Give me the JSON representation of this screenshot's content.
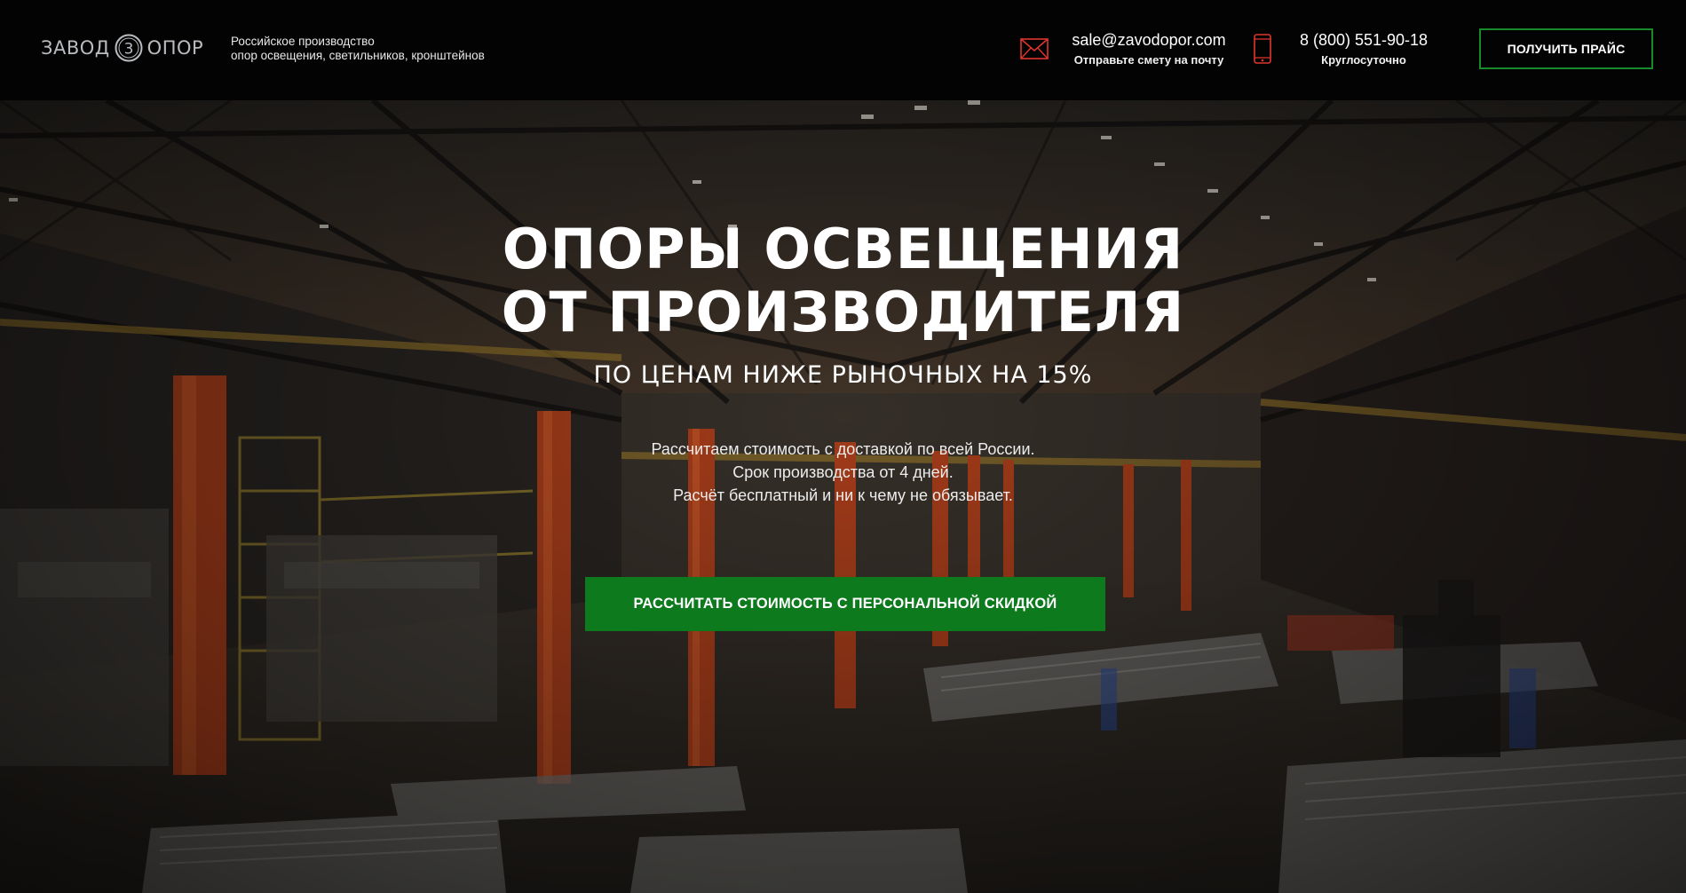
{
  "header": {
    "logo": {
      "word_left": "ЗАВОД",
      "mark_letter": "3",
      "word_right": "ОПОР",
      "icon": "factory-logo-icon"
    },
    "tagline": {
      "line1": "Российское производство",
      "line2": "опор освещения, светильников, кронштейнов"
    },
    "email": {
      "icon": "mail-icon",
      "address": "sale@zavodopor.com",
      "caption": "Отправьте смету на почту"
    },
    "phone": {
      "icon": "phone-icon",
      "number": "8 (800) 551-90-18",
      "caption": "Круглосуточно"
    },
    "price_button": "ПОЛУЧИТЬ ПРАЙС"
  },
  "hero": {
    "title_line1": "ОПОРЫ ОСВЕЩЕНИЯ",
    "title_line2": "ОТ ПРОИЗВОДИТЕЛЯ",
    "subtitle": "ПО ЦЕНАМ НИЖЕ РЫНОЧНЫХ НА 15%",
    "text_line1": "Рассчитаем стоимость с доставкой по всей России.",
    "text_line2": "Срок производства от 4 дней.",
    "text_line3": "Расчёт бесплатный и ни к чему не обязывает.",
    "cta_button": "РАССЧИТАТЬ СТОИМОСТЬ С ПЕРСОНАЛЬНОЙ СКИДКОЙ",
    "background": "factory-hall-photo"
  },
  "colors": {
    "accent_green": "#0c7a1d",
    "button_border_green": "#188a2c",
    "icon_red": "#e0342c",
    "header_bg": "#030303"
  }
}
